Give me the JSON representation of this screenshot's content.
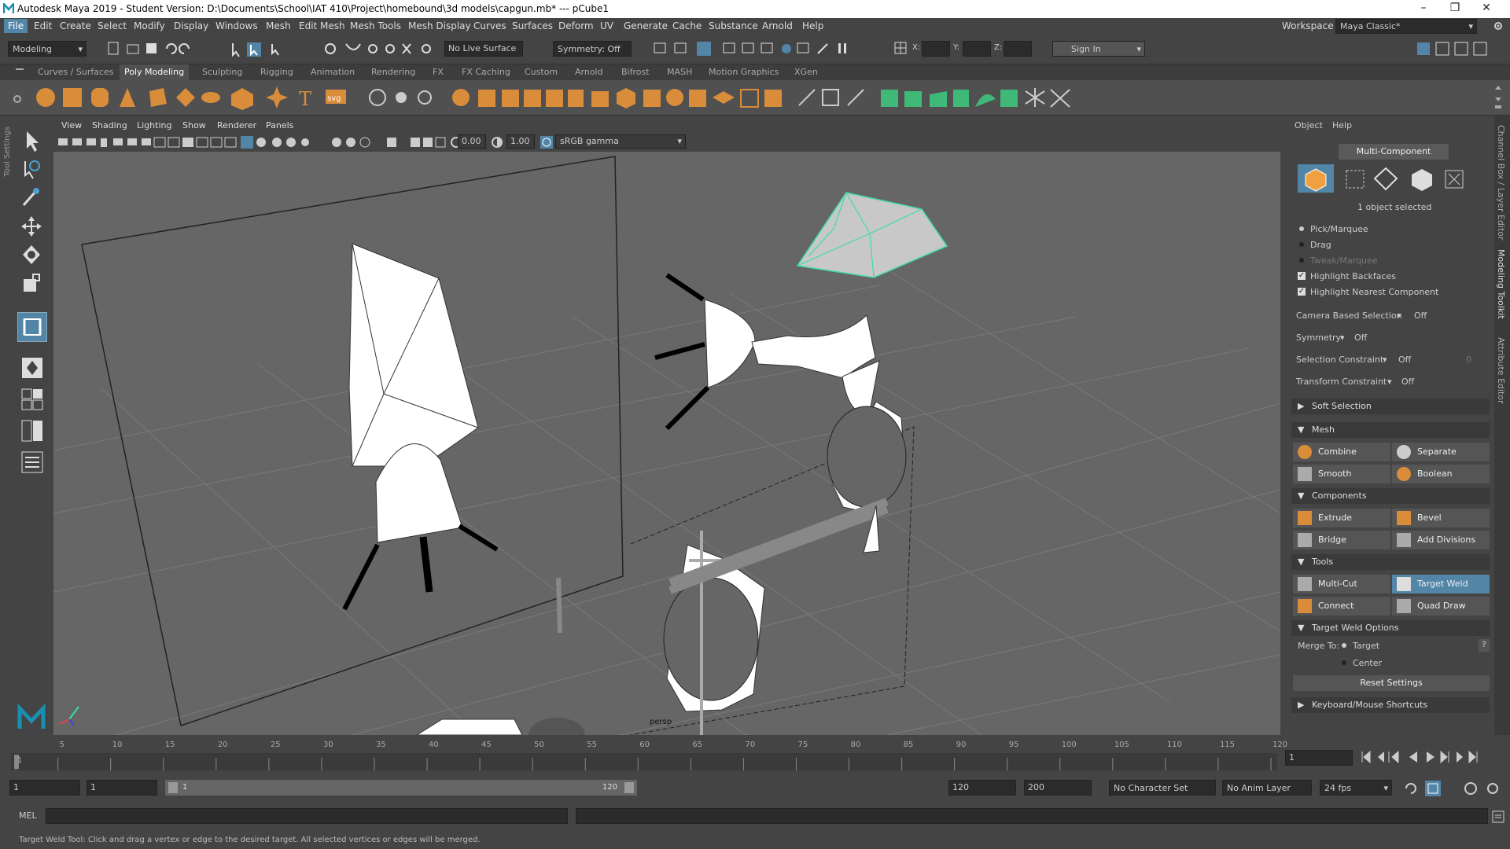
{
  "title_bar": {
    "text": "Autodesk Maya 2019 - Student Version: D:\\Documents\\School\\IAT 410\\Project\\homebound\\3d models\\capgun.mb*   ---   pCube1"
  },
  "menus": [
    "File",
    "Edit",
    "Create",
    "Select",
    "Modify",
    "Display",
    "Windows",
    "Mesh",
    "Edit Mesh",
    "Mesh Tools",
    "Mesh Display",
    "Curves",
    "Surfaces",
    "Deform",
    "UV",
    "Generate",
    "Cache",
    "Substance",
    "Arnold",
    "Help"
  ],
  "workspace": {
    "label": "Workspace :",
    "value": "Maya Classic*"
  },
  "status_line": {
    "menuset": "Modeling",
    "live_surface": "No Live Surface",
    "symmetry": "Symmetry: Off",
    "x_label": "X:",
    "y_label": "Y:",
    "z_label": "Z:",
    "sign_in": "Sign In"
  },
  "shelf_tabs": [
    "Curves / Surfaces",
    "Poly Modeling",
    "Sculpting",
    "Rigging",
    "Animation",
    "Rendering",
    "FX",
    "FX Caching",
    "Custom",
    "Arnold",
    "Bifrost",
    "MASH",
    "Motion Graphics",
    "XGen"
  ],
  "shelf_tabs_selected": "Poly Modeling",
  "viewport": {
    "menus": [
      "View",
      "Shading",
      "Lighting",
      "Show",
      "Renderer",
      "Panels"
    ],
    "exposure": "0.00",
    "gamma": "1.00",
    "color_space": "sRGB gamma",
    "camera_label": "persp"
  },
  "right_panel": {
    "tabs": [
      "Object",
      "Help"
    ],
    "mode": "Multi-Component",
    "selection_count": "1 object selected",
    "pick_marquee": "Pick/Marquee",
    "drag": "Drag",
    "tweak_marquee": "Tweak/Marquee",
    "highlight_backfaces": "Highlight Backfaces",
    "highlight_nearest": "Highlight Nearest Component",
    "camera_based": "Camera Based Selection",
    "camera_based_value": "Off",
    "symmetry": "Symmetry",
    "symmetry_value": "Off",
    "selection_constraint": "Selection Constraint",
    "selection_constraint_value": "Off",
    "selection_constraint_num": "0",
    "transform_constraint": "Transform Constraint",
    "transform_constraint_value": "Off",
    "soft_selection": "Soft Selection",
    "mesh_header": "Mesh",
    "combine": "Combine",
    "separate": "Separate",
    "smooth": "Smooth",
    "boolean": "Boolean",
    "components_header": "Components",
    "extrude": "Extrude",
    "bevel": "Bevel",
    "bridge": "Bridge",
    "add_divisions": "Add Divisions",
    "tools_header": "Tools",
    "multi_cut": "Multi-Cut",
    "target_weld": "Target Weld",
    "connect": "Connect",
    "quad_draw": "Quad Draw",
    "target_weld_options": "Target Weld Options",
    "merge_to": "Merge To:",
    "target": "Target",
    "center": "Center",
    "help_q": "?",
    "reset_settings": "Reset Settings",
    "keyboard_shortcuts": "Keyboard/Mouse Shortcuts"
  },
  "vertical_tabs": [
    "Channel Box / Layer Editor",
    "Modeling Toolkit",
    "Attribute Editor"
  ],
  "left_vertical_tab": "Tool Settings",
  "timeline": {
    "ticks": [
      "1",
      "5",
      "10",
      "15",
      "20",
      "25",
      "30",
      "35",
      "40",
      "45",
      "50",
      "55",
      "60",
      "65",
      "70",
      "75",
      "80",
      "85",
      "90",
      "95",
      "100",
      "105",
      "110",
      "115",
      "120"
    ],
    "current_frame": "1"
  },
  "range": {
    "start": "1",
    "playback_start": "1",
    "slider_start": "1",
    "slider_end": "120",
    "playback_end": "120",
    "end": "200",
    "character_set": "No Character Set",
    "anim_layer": "No Anim Layer",
    "fps": "24 fps"
  },
  "command_line": {
    "label": "MEL"
  },
  "help_line": "Target Weld Tool: Click and drag a vertex or edge to the desired target. All selected vertices or edges will be merged.",
  "colors": {
    "accent": "#5285a6",
    "selection_green": "#3fdca0",
    "icon_orange": "#d98c3a"
  }
}
